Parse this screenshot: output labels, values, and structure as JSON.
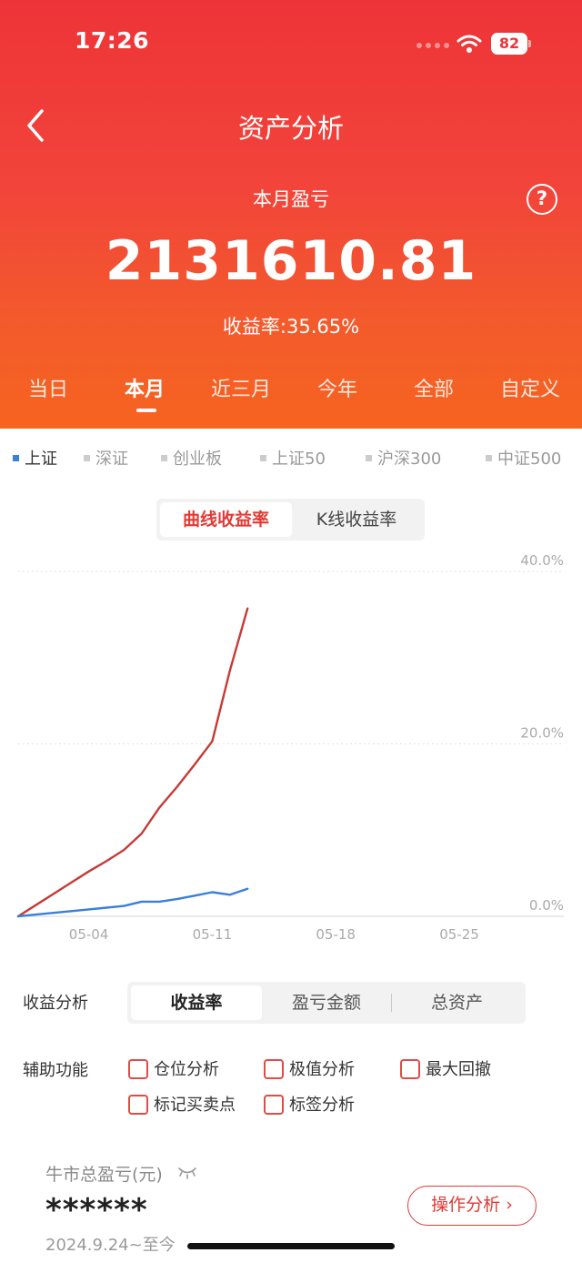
{
  "status_bar": {
    "time": "17:26",
    "battery": "82"
  },
  "header": {
    "title": "资产分析",
    "summary_label": "本月盈亏",
    "summary_value": "2131610.81",
    "rate_label": "收益率:35.65%",
    "help_glyph": "?"
  },
  "period_tabs": [
    "当日",
    "本月",
    "近三月",
    "今年",
    "全部",
    "自定义"
  ],
  "period_active": "本月",
  "index_legend": [
    "上证",
    "深证",
    "创业板",
    "上证50",
    "沪深300",
    "中证500"
  ],
  "index_active": "上证",
  "chart_toggle": {
    "active": "曲线收益率",
    "inactive": "K线收益率"
  },
  "chart_data": {
    "type": "line",
    "x_tick_labels": [
      "05-04",
      "05-11",
      "05-18",
      "05-25"
    ],
    "y_tick_labels": [
      "40.0%",
      "20.0%",
      "0.0%"
    ],
    "ylim": [
      0,
      40
    ],
    "grid": true,
    "series": [
      {
        "name": "",
        "color": "#c63a35",
        "x": [
          "04-30",
          "05-01",
          "05-02",
          "05-03",
          "05-04",
          "05-05",
          "05-06",
          "05-07",
          "05-08",
          "05-09",
          "05-10",
          "05-11",
          "05-12",
          "05-13"
        ],
        "y": [
          0,
          1.3,
          2.6,
          3.9,
          5.2,
          6.4,
          7.7,
          9.6,
          12.6,
          15.0,
          17.6,
          20.3,
          28.5,
          35.7
        ]
      },
      {
        "name": "上证",
        "color": "#3a7fd8",
        "x": [
          "04-30",
          "05-01",
          "05-02",
          "05-03",
          "05-04",
          "05-05",
          "05-06",
          "05-07",
          "05-08",
          "05-09",
          "05-10",
          "05-11",
          "05-12",
          "05-13"
        ],
        "y": [
          0,
          0.2,
          0.4,
          0.6,
          0.8,
          1.0,
          1.2,
          1.7,
          1.7,
          2.0,
          2.4,
          2.8,
          2.5,
          3.2
        ]
      }
    ]
  },
  "analysis": {
    "label": "收益分析",
    "options": [
      "收益率",
      "盈亏金额",
      "总资产"
    ],
    "active": "收益率"
  },
  "aux": {
    "label": "辅助功能",
    "options": [
      "仓位分析",
      "极值分析",
      "最大回撤",
      "标记买卖点",
      "标签分析"
    ]
  },
  "bull": {
    "title": "牛市总盈亏(元)",
    "value": "******",
    "date": "2024.9.24~至今",
    "button": "操作分析 ›"
  },
  "colors": {
    "brand_red": "#ee3338",
    "orange": "#f6641f",
    "index_blue": "#3a7fd8"
  }
}
